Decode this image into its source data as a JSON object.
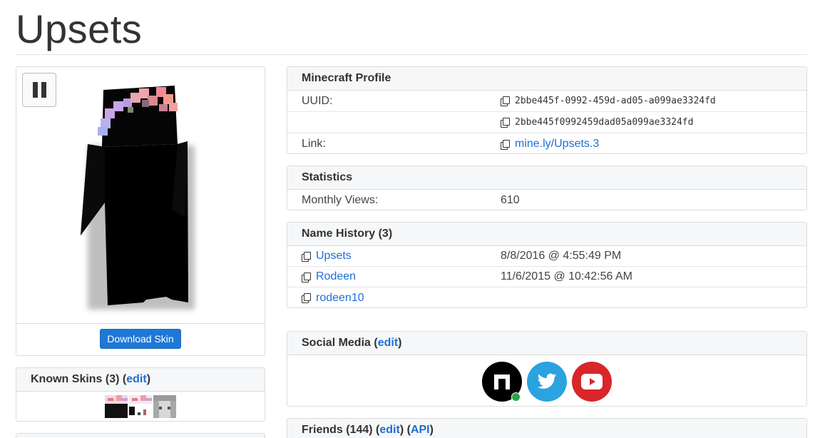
{
  "page": {
    "title": "Upsets"
  },
  "skin_viewer": {
    "download_label": "Download Skin",
    "pause_icon": "pause-icon"
  },
  "known_skins": {
    "title": "Known Skins (3)",
    "edit_label": "edit",
    "count": 3
  },
  "profile": {
    "title": "Minecraft Profile",
    "uuid_label": "UUID:",
    "uuid": "2bbe445f-0992-459d-ad05-a099ae3324fd",
    "uuid_short": "2bbe445f0992459dad05a099ae3324fd",
    "link_label": "Link:",
    "link": "mine.ly/Upsets.3"
  },
  "statistics": {
    "title": "Statistics",
    "views_label": "Monthly Views:",
    "views": "610"
  },
  "name_history": {
    "title": "Name History (3)",
    "items": [
      {
        "name": "Upsets",
        "date": "8/8/2016 @ 4:55:49 PM"
      },
      {
        "name": "Rodeen",
        "date": "11/6/2015 @ 10:42:56 AM"
      },
      {
        "name": "rodeen10",
        "date": ""
      }
    ]
  },
  "social": {
    "title": "Social Media",
    "edit_label": "edit",
    "icons": [
      "namemc-icon",
      "twitter-icon",
      "youtube-icon"
    ]
  },
  "friends": {
    "title": "Friends (144)",
    "edit_label": "edit",
    "api_label": "API"
  },
  "colors": {
    "link": "#1f6fd6",
    "button": "#1f78d6",
    "twitter": "#2aa3e0",
    "youtube": "#d8262a",
    "verified": "#28a745"
  }
}
